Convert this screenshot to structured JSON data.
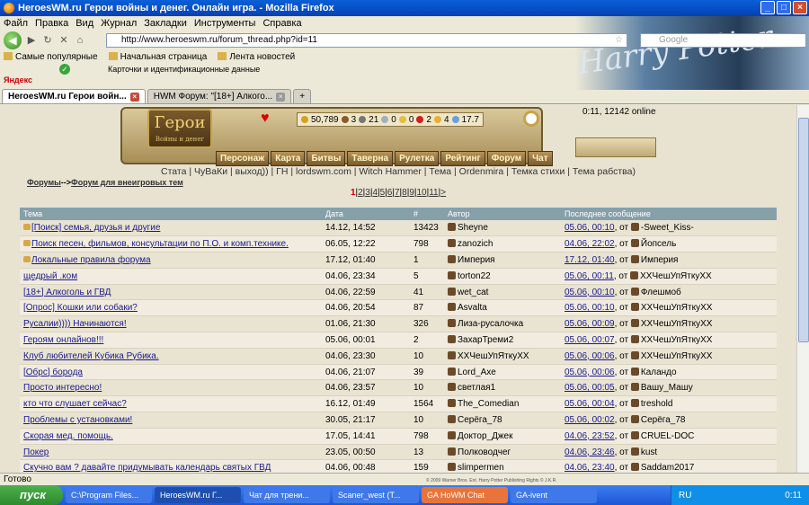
{
  "window": {
    "title": "HeroesWM.ru Герои войны и денег. Онлайн игра. - Mozilla Firefox"
  },
  "menu": [
    "Файл",
    "Правка",
    "Вид",
    "Журнал",
    "Закладки",
    "Инструменты",
    "Справка"
  ],
  "address": {
    "url": "http://www.heroeswm.ru/forum_thread.php?id=11"
  },
  "search": {
    "placeholder": "Google"
  },
  "bookmarks": [
    "Самые популярные",
    "Начальная страница",
    "Лента новостей"
  ],
  "ext_row": {
    "label": "Карточки и идентификационные данные"
  },
  "yandex": "Яндекс",
  "banner_text": "Harry Potter",
  "tabs": [
    {
      "label": "HeroesWM.ru Герои войн..."
    },
    {
      "label": "HWM Форум: \"[18+] Алкого..."
    }
  ],
  "game": {
    "logo": "Герои",
    "logo_sub": "Войны и денег",
    "resources": [
      "50,789",
      "3",
      "21",
      "0",
      "0",
      "2",
      "4",
      "17.7"
    ],
    "online": "0:11, 12142 online",
    "menu": [
      "Персонаж",
      "Карта",
      "Битвы",
      "Таверна",
      "Рулетка",
      "Рейтинг",
      "Форум",
      "Чат"
    ]
  },
  "links": "Стата | ЧуВаКи | выход)) | ГН | lordswm.com | Witch Hammer | Тема | Ordenmira | Темка стихи | Тема рабства)",
  "breadcrumb": {
    "forums": "Форумы",
    "sep": "-->",
    "current": "Форум для внеигровых тем"
  },
  "pagination": {
    "current": "1",
    "pages": [
      "2",
      "3",
      "4",
      "5",
      "6",
      "7",
      "8",
      "9",
      "10",
      "11"
    ],
    "next": ">"
  },
  "table": {
    "headers": [
      "Тема",
      "Дата",
      "#",
      "Автор",
      "Последнее сообщение"
    ],
    "rows": [
      {
        "topic": "[Поиск] семья, друзья и другие",
        "date": "14.12, 14:52",
        "count": "13423",
        "author": "Sheyne",
        "last_date": "05.06, 00:10",
        "last_sep": ", от",
        "last_author": "-Sweet_Kiss-"
      },
      {
        "topic": "Поиск песен, фильмов, консультации по П.О. и комп.технике.",
        "date": "06.05, 12:22",
        "count": "798",
        "author": "zanozich",
        "last_date": "04.06, 22:02",
        "last_sep": ", от",
        "last_author": "Йопсель"
      },
      {
        "topic": "Локальные правила форума",
        "date": "17.12, 01:40",
        "count": "1",
        "author": "Империя",
        "last_date": "17.12, 01:40",
        "last_sep": ", от",
        "last_author": "Империя"
      },
      {
        "topic": "щедрый .ком",
        "date": "04.06, 23:34",
        "count": "5",
        "author": "torton22",
        "last_date": "05.06, 00:11",
        "last_sep": ", от",
        "last_author": "ХХЧешУпЯткуХХ"
      },
      {
        "topic": "[18+] Алкоголь и ГВД",
        "date": "04.06, 22:59",
        "count": "41",
        "author": "wet_cat",
        "last_date": "05.06, 00:10",
        "last_sep": ", от",
        "last_author": "Флешмоб"
      },
      {
        "topic": "[Опрос] Кошки или собаки?",
        "date": "04.06, 20:54",
        "count": "87",
        "author": "Asvalta",
        "last_date": "05.06, 00:10",
        "last_sep": ", от",
        "last_author": "ХХЧешУпЯткуХХ"
      },
      {
        "topic": "Русалии)))) Начинаются!",
        "date": "01.06, 21:30",
        "count": "326",
        "author": "Лиза-русалочка",
        "last_date": "05.06, 00:09",
        "last_sep": ", от",
        "last_author": "ХХЧешУпЯткуХХ"
      },
      {
        "topic": "Героям онлайнов!!!",
        "date": "05.06, 00:01",
        "count": "2",
        "author": "ЗахарТреми2",
        "last_date": "05.06, 00:07",
        "last_sep": ", от",
        "last_author": "ХХЧешУпЯткуХХ"
      },
      {
        "topic": "Клуб любителей Кубика Рубика.",
        "date": "04.06, 23:30",
        "count": "10",
        "author": "ХХЧешУпЯткуХХ",
        "last_date": "05.06, 00:06",
        "last_sep": ", от",
        "last_author": "ХХЧешУпЯткуХХ"
      },
      {
        "topic": "[Обрс] борода",
        "date": "04.06, 21:07",
        "count": "39",
        "author": "Lord_Axe",
        "last_date": "05.06, 00:06",
        "last_sep": ", от",
        "last_author": "Каландо"
      },
      {
        "topic": "Просто интересно!",
        "date": "04.06, 23:57",
        "count": "10",
        "author": "светлая1",
        "last_date": "05.06, 00:05",
        "last_sep": ", от",
        "last_author": "Вашу_Машу"
      },
      {
        "topic": "кто что слушает сейчас?",
        "date": "16.12, 01:49",
        "count": "1564",
        "author": "The_Comedian",
        "last_date": "05.06, 00:04",
        "last_sep": ", от",
        "last_author": "treshold"
      },
      {
        "topic": "Проблемы с установками!",
        "date": "30.05, 21:17",
        "count": "10",
        "author": "Серёга_78",
        "last_date": "05.06, 00:02",
        "last_sep": ", от",
        "last_author": "Серёга_78"
      },
      {
        "topic": "Скорая мед. помощь.",
        "date": "17.05, 14:41",
        "count": "798",
        "author": "Доктор_Джек",
        "last_date": "04.06, 23:52",
        "last_sep": ", от",
        "last_author": "CRUEL-DOC"
      },
      {
        "topic": "Покер",
        "date": "23.05, 00:50",
        "count": "13",
        "author": "Полководчег",
        "last_date": "04.06, 23:46",
        "last_sep": ", от",
        "last_author": "kust"
      },
      {
        "topic": "Скучно вам ? давайте придумывать календарь святых ГВД",
        "date": "04.06, 00:48",
        "count": "159",
        "author": "slimpermen",
        "last_date": "04.06, 23:40",
        "last_sep": ", от",
        "last_author": "Saddam2017"
      }
    ]
  },
  "status": {
    "text": "Готово",
    "copyright": "© 2009 Warner Bros. Ent. Harry Potter Publishing Rights © J.K.R."
  },
  "taskbar": {
    "start": "пуск",
    "tasks": [
      "C:\\Program Files...",
      "HeroesWM.ru Г...",
      "Чат для трени...",
      "Scaner_west (Т...",
      "GA HoWM Chat",
      "GA-ivent"
    ],
    "lang": "RU",
    "time": "0:11"
  }
}
